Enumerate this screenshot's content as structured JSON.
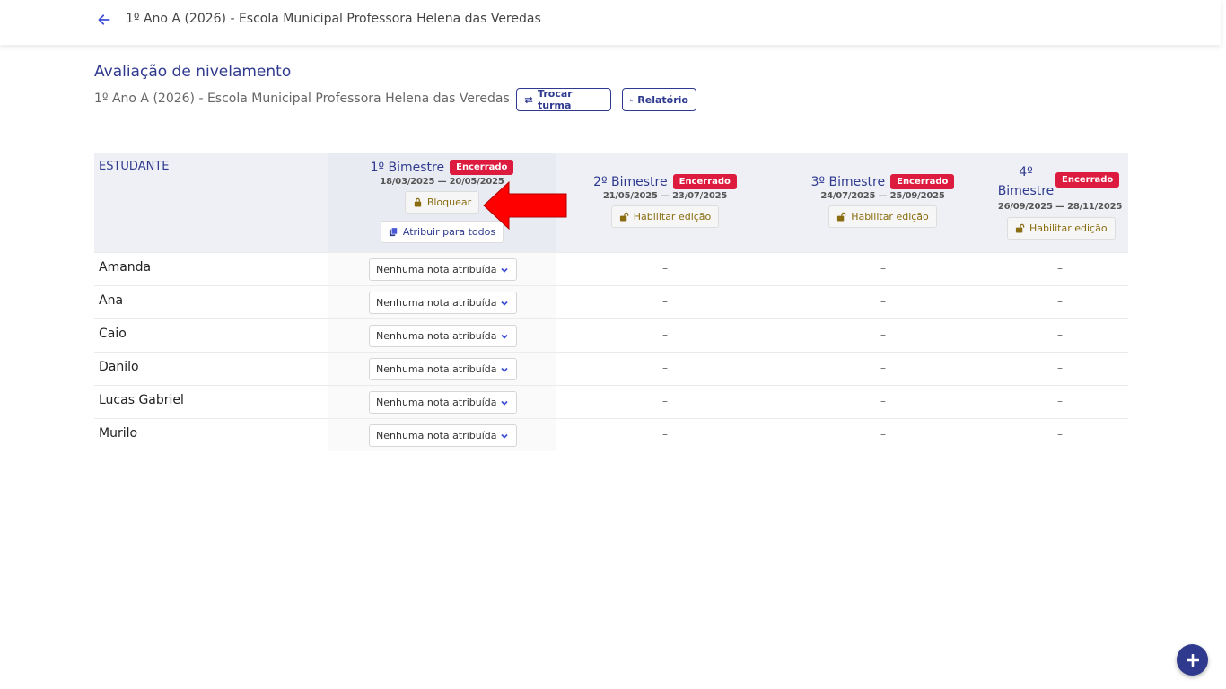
{
  "header": {
    "breadcrumb": "1º Ano A (2026) - Escola Municipal Professora Helena das Veredas"
  },
  "page": {
    "title": "Avaliação de nivelamento",
    "subtitle": "1º Ano A (2026) - Escola Municipal Professora Helena das Veredas",
    "switch_class_label": "Trocar turma",
    "report_label": "Relatório"
  },
  "table": {
    "student_header": "ESTUDANTE",
    "periods": [
      {
        "title": "1º Bimestre",
        "status": "Encerrado",
        "dates": "18/03/2025 — 20/05/2025",
        "action": "Bloquear",
        "assign_all": "Atribuir para todos"
      },
      {
        "title": "2º Bimestre",
        "status": "Encerrado",
        "dates": "21/05/2025 — 23/07/2025",
        "action": "Habilitar edição"
      },
      {
        "title": "3º Bimestre",
        "status": "Encerrado",
        "dates": "24/07/2025 — 25/09/2025",
        "action": "Habilitar edição"
      },
      {
        "title_line1": "4º",
        "title_line2": "Bimestre",
        "status": "Encerrado",
        "dates": "26/09/2025 — 28/11/2025",
        "action": "Habilitar edição"
      }
    ],
    "empty_mark": "–",
    "select_placeholder": "Nenhuma nota atribuída",
    "students": [
      "Amanda",
      "Ana",
      "Caio",
      "Danilo",
      "Lucas Gabriel",
      "Murilo"
    ]
  },
  "colors": {
    "primary": "#2f3a8f",
    "badge": "#dc1b3e",
    "arrow": "#ff0000",
    "lock": "#8a6d10"
  },
  "icons": {
    "back": "arrow-left-icon",
    "swap": "swap-icon",
    "chart": "bar-chart-icon",
    "lock": "lock-icon",
    "unlock": "unlock-icon",
    "copy": "copy-icon",
    "chevron": "chevron-down-icon",
    "plus": "plus-icon",
    "annotation": "red-arrow-icon"
  }
}
